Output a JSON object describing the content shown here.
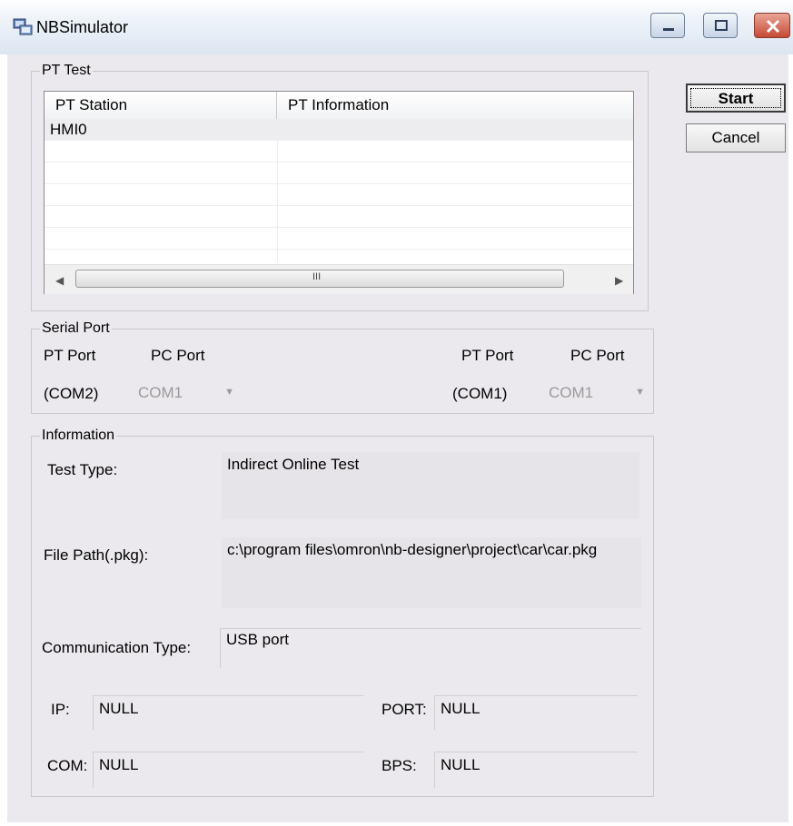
{
  "window": {
    "title": "NBSimulator",
    "app_icon": "app-icon",
    "buttons": [
      "minimize-icon",
      "maximize-icon",
      "close-icon"
    ]
  },
  "pt_test": {
    "group_label": "PT Test",
    "columns": [
      "PT Station",
      "PT Information"
    ],
    "rows": [
      {
        "station": "HMI0",
        "information": ""
      }
    ],
    "scroll_grip": "III"
  },
  "actions": {
    "start_label": "Start",
    "cancel_label": "Cancel"
  },
  "serial_port": {
    "group_label": "Serial Port",
    "left": {
      "pt_port_label": "PT Port",
      "pc_port_label": "PC Port",
      "pt_port_value": "(COM2)",
      "pc_port_value": "COM1"
    },
    "right": {
      "pt_port_label": "PT Port",
      "pc_port_label": "PC Port",
      "pt_port_value": "(COM1)",
      "pc_port_value": "COM1"
    }
  },
  "information": {
    "group_label": "Information",
    "test_type_label": "Test Type:",
    "test_type_value": "Indirect Online Test",
    "file_path_label": "File Path(.pkg):",
    "file_path_value": "c:\\program files\\omron\\nb-designer\\project\\car\\car.pkg",
    "comm_type_label": "Communication Type:",
    "comm_type_value": "USB port",
    "ip_label": "IP:",
    "ip_value": "NULL",
    "port_label": "PORT:",
    "port_value": "NULL",
    "com_label": "COM:",
    "com_value": "NULL",
    "bps_label": "BPS:",
    "bps_value": "NULL"
  }
}
